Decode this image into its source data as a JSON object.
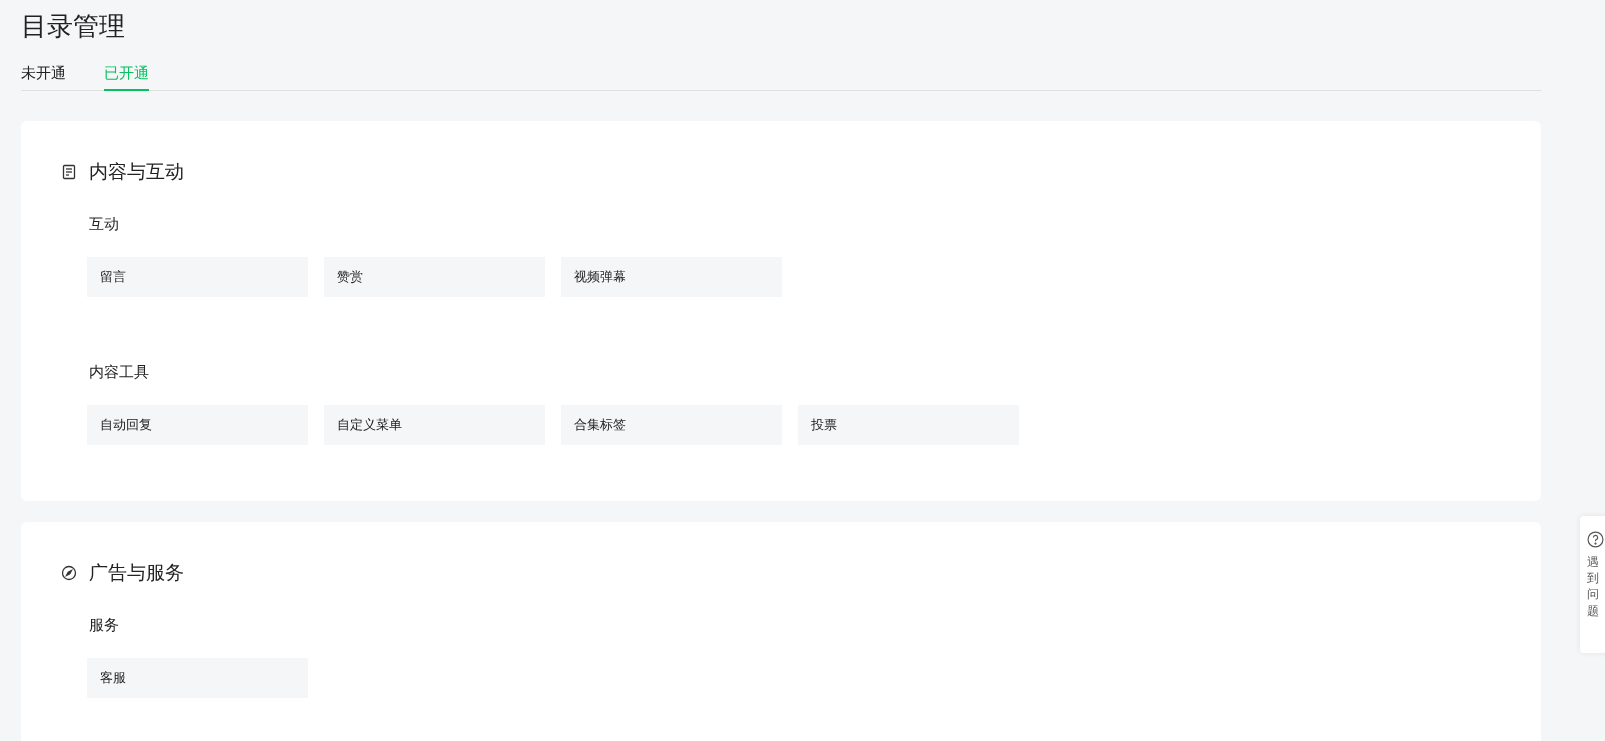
{
  "page_title": "目录管理",
  "tabs": [
    {
      "label": "未开通",
      "selected": false
    },
    {
      "label": "已开通",
      "selected": true
    }
  ],
  "sections": [
    {
      "title": "内容与互动",
      "groups": [
        {
          "title": "互动",
          "items": [
            "留言",
            "赞赏",
            "视频弹幕"
          ]
        },
        {
          "title": "内容工具",
          "items": [
            "自动回复",
            "自定义菜单",
            "合集标签",
            "投票"
          ]
        }
      ]
    },
    {
      "title": "广告与服务",
      "groups": [
        {
          "title": "服务",
          "items": [
            "客服"
          ]
        }
      ]
    }
  ],
  "help_widget": {
    "label": "遇到问题"
  }
}
